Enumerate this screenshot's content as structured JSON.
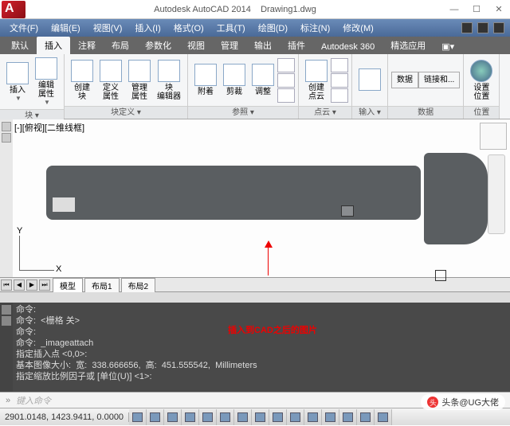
{
  "title": {
    "app": "Autodesk AutoCAD 2014",
    "file": "Drawing1.dwg"
  },
  "menu": {
    "file": "文件(F)",
    "edit": "编辑(E)",
    "view": "视图(V)",
    "insert": "插入(I)",
    "format": "格式(O)",
    "tools": "工具(T)",
    "draw": "绘图(D)",
    "dimension": "标注(N)",
    "modify": "修改(M)"
  },
  "tabs": {
    "default": "默认",
    "insert": "插入",
    "annotate": "注释",
    "layout": "布局",
    "param": "参数化",
    "view": "视图",
    "manage": "管理",
    "output": "输出",
    "plugin": "插件",
    "a360": "Autodesk 360",
    "featured": "精选应用"
  },
  "ribbon": {
    "g1": {
      "title": "块 ▾",
      "insert": "插入",
      "editattr": "编辑\n属性"
    },
    "g2": {
      "title": "块定义 ▾",
      "create": "创建\n块",
      "define": "定义\n属性",
      "manage": "管理\n属性",
      "block": "块\n编辑器"
    },
    "g3": {
      "title": "参照 ▾",
      "attach": "附着",
      "clip": "剪裁",
      "adjust": "调整"
    },
    "g4": {
      "title": "点云 ▾",
      "createpc": "创建\n点云"
    },
    "g5": {
      "title": "输入 ▾"
    },
    "g6": {
      "title": "数据",
      "data": "数据",
      "link": "链接和..."
    },
    "g7": {
      "title": "位置",
      "setloc": "设置\n位置"
    }
  },
  "viewport_label": "[-][俯视][二维线框]",
  "ucs": {
    "x": "X",
    "y": "Y"
  },
  "layout_tabs": {
    "model": "模型",
    "l1": "布局1",
    "l2": "布局2"
  },
  "cmd": {
    "l1": "命令:",
    "l2": "命令:  <栅格 关>",
    "l3": "命令:",
    "l4": "命令:  _imageattach",
    "l5": "指定插入点 <0,0>:",
    "l6": "基本图像大小:  宽:  338.666656,  高:  451.555542,  Millimeters",
    "l7": "指定缩放比例因子或 [单位(U)] <1>:",
    "prompt": "键入命令"
  },
  "annotation": "插入到CAD之后的图片",
  "status": {
    "coords": "2901.0148, 1423.9411, 0.0000"
  },
  "watermark": "头条@UG大佬"
}
